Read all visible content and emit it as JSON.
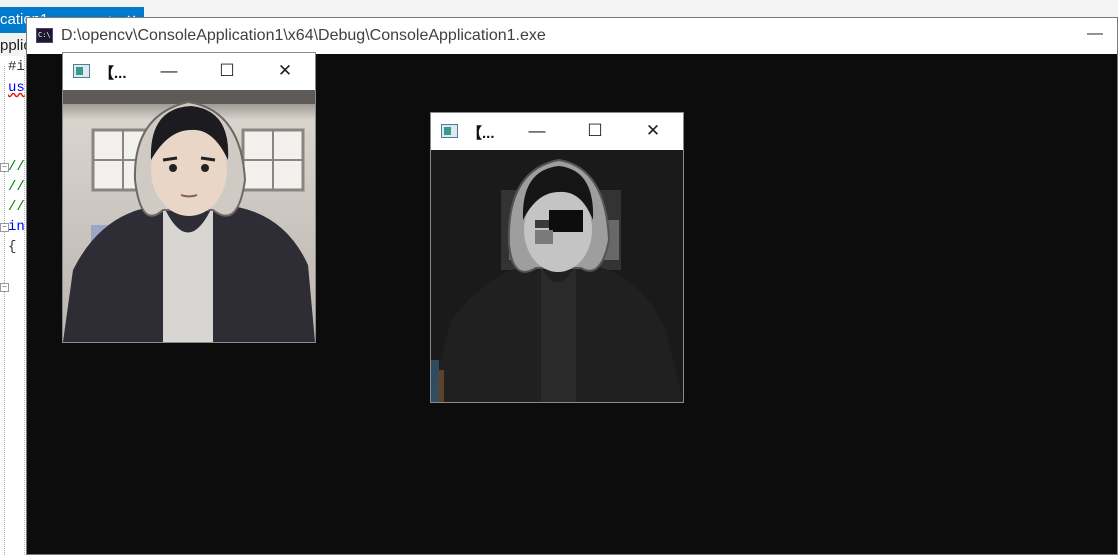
{
  "background_ide": {
    "tab_label": "cation1",
    "project_label": "pplic",
    "code_lines": [
      "#i",
      "us",
      "//",
      "//",
      "//",
      "in",
      "{"
    ]
  },
  "console": {
    "title": "D:\\opencv\\ConsoleApplication1\\x64\\Debug\\ConsoleApplication1.exe",
    "icon_text": "C:\\",
    "minimize_glyph": "—"
  },
  "image_windows": [
    {
      "title": "【...",
      "minimize_glyph": "—",
      "maximize_glyph": "☐",
      "close_glyph": "✕",
      "image_description": "original"
    },
    {
      "title": "【...",
      "minimize_glyph": "—",
      "maximize_glyph": "☐",
      "close_glyph": "✕",
      "image_description": "processed"
    }
  ],
  "colors": {
    "console_bg": "#0c0c0c",
    "vs_accent": "#007acc"
  }
}
